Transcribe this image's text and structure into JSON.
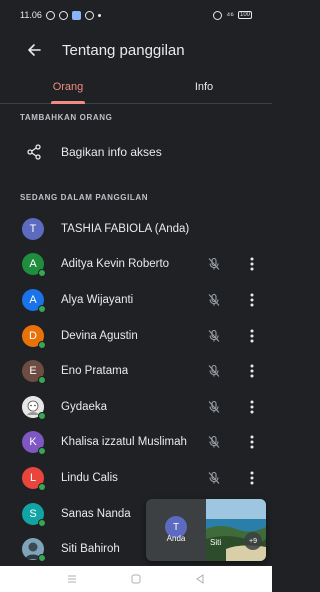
{
  "status_bar": {
    "time": "11.06",
    "signal": "⁴⁶",
    "battery": "100"
  },
  "header": {
    "title": "Tentang panggilan"
  },
  "tabs": [
    {
      "label": "Orang",
      "active": true
    },
    {
      "label": "Info",
      "active": false
    }
  ],
  "sections": {
    "add_people": "TAMBAHKAN ORANG",
    "in_call": "SEDANG DALAM PANGGILAN"
  },
  "share": {
    "label": "Bagikan info akses"
  },
  "participants": [
    {
      "initial": "T",
      "name": "TASHIA FABIOLA (Anda)",
      "color": "#5c6bc0",
      "online": false,
      "controls": false
    },
    {
      "initial": "A",
      "name": "Aditya Kevin Roberto",
      "color": "#1e8e3e",
      "online": true,
      "controls": true
    },
    {
      "initial": "A",
      "name": "Alya Wijayanti",
      "color": "#1a73e8",
      "online": true,
      "controls": true
    },
    {
      "initial": "D",
      "name": "Devina Agustin",
      "color": "#e8710a",
      "online": true,
      "controls": true
    },
    {
      "initial": "E",
      "name": "Eno Pratama",
      "color": "#6d4c41",
      "online": true,
      "controls": true
    },
    {
      "initial": "",
      "name": "Gydaeka",
      "color": "#cfcfcf",
      "online": true,
      "controls": true,
      "photo": "cartoon"
    },
    {
      "initial": "K",
      "name": "Khalisa izzatul Muslimah",
      "color": "#7e57c2",
      "online": true,
      "controls": true
    },
    {
      "initial": "L",
      "name": "Lindu Calis",
      "color": "#e8453c",
      "online": true,
      "controls": true
    },
    {
      "initial": "S",
      "name": "Sanas Nanda",
      "color": "#12a4a4",
      "online": true,
      "controls": false
    },
    {
      "initial": "",
      "name": "Siti Bahiroh",
      "color": "#6b8fa3",
      "online": true,
      "controls": false,
      "photo": "person"
    }
  ],
  "floating_tile": {
    "self_initial": "T",
    "self_label": "Anda",
    "other_label": "Siti",
    "extra_count": "+9"
  },
  "icons": {
    "back": "arrow-left-icon",
    "share": "share-icon",
    "mute": "mic-off-icon",
    "more": "more-vert-icon"
  },
  "colors": {
    "accent": "#f28b82",
    "background": "#202124",
    "online": "#34a853"
  }
}
